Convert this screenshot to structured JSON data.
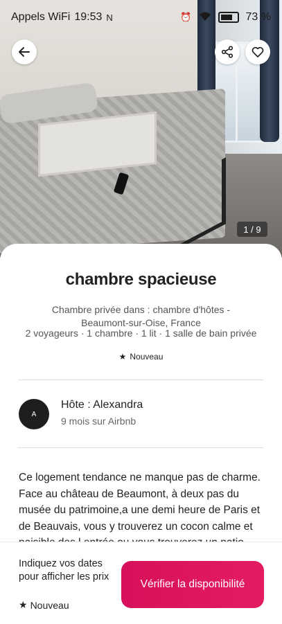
{
  "status_bar": {
    "carrier": "Appels WiFi",
    "time": "19:53",
    "battery": "73 %"
  },
  "photo": {
    "counter": "1 / 9"
  },
  "listing": {
    "title": "chambre spacieuse",
    "subtitle": "Chambre privée dans : chambre d'hôtes - Beaumont-sur-Oise, France",
    "details": "2 voyageurs · 1 chambre · 1 lit · 1 salle de bain privée",
    "badge": "Nouveau"
  },
  "host": {
    "avatar_initial": "A",
    "name": "Hôte : Alexandra",
    "meta": "9 mois sur Airbnb"
  },
  "description": "Ce logement tendance ne manque pas de charme. Face au château de Beaumont, à deux pas du musée du patrimoine,a une demi heure de Paris et de Beauvais, vous y trouverez un cocon calme et paisible des l entrée ou vous trouverez un patio",
  "bottom_bar": {
    "dates_prompt": "Indiquez vos dates pour afficher les prix",
    "badge": "Nouveau",
    "cta_label": "Vérifier la disponibilité"
  },
  "colors": {
    "brand_pink": "#E31C62",
    "text_primary": "#222222"
  },
  "icons": [
    "back-arrow-icon",
    "share-icon",
    "heart-icon",
    "star-icon",
    "wifi-icon",
    "alarm-icon",
    "nfc-icon",
    "battery-icon"
  ]
}
